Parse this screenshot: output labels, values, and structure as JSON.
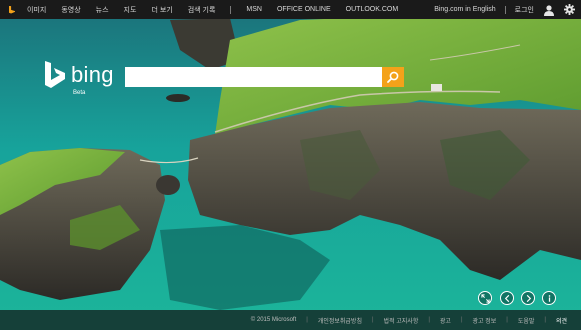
{
  "topbar": {
    "nav_items": [
      "이미지",
      "동영상",
      "뉴스",
      "지도",
      "더 보기",
      "검색 기록"
    ],
    "links_after_sep": [
      "MSN",
      "OFFICE ONLINE",
      "OUTLOOK.COM"
    ],
    "english_link": "Bing.com in English",
    "login": "로그인",
    "icons": [
      "bing-mini-logo-icon",
      "user-icon",
      "gear-icon"
    ]
  },
  "brand": {
    "word": "bing",
    "beta": "Beta"
  },
  "search": {
    "placeholder": "",
    "value": "",
    "button_icon": "search-icon"
  },
  "image_nav": {
    "icons": [
      "expand-icon",
      "previous-icon",
      "next-icon",
      "info-icon"
    ]
  },
  "footer": {
    "copyright": "© 2015 Microsoft",
    "links": [
      "개인정보취급방침",
      "법적 고지사항",
      "광고",
      "광고 정보",
      "도움말"
    ],
    "last": "의견"
  },
  "colors": {
    "accent": "#f4a21a",
    "topbar": "#1a1a1a",
    "sea": "#1fa39a"
  }
}
